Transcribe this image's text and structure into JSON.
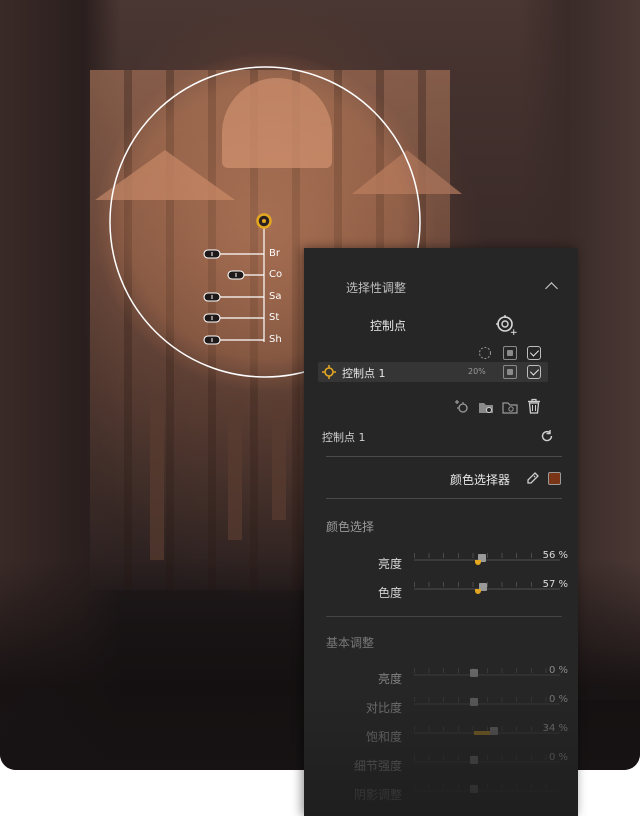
{
  "overlay": {
    "labels": [
      "Br",
      "Co",
      "Sa",
      "St",
      "Sh"
    ],
    "accent_color": "#e4a820"
  },
  "panel": {
    "section_title": "选择性调整",
    "control_points_label": "控制点",
    "control_point_item": {
      "name": "控制点 1",
      "opacity": "20%"
    },
    "selected_point_title": "控制点 1",
    "color_picker_label": "颜色选择器",
    "color_swatch": "#7a3416",
    "color_selection": {
      "title": "颜色选择",
      "sliders": [
        {
          "label": "亮度",
          "value": "56 %"
        },
        {
          "label": "色度",
          "value": "57 %"
        }
      ]
    },
    "basic_adjust": {
      "title": "基本调整",
      "sliders": [
        {
          "label": "亮度",
          "value": "0 %"
        },
        {
          "label": "对比度",
          "value": "0 %"
        },
        {
          "label": "饱和度",
          "value": "34 %"
        },
        {
          "label": "细节强度",
          "value": "0 %"
        },
        {
          "label": "阴影调整",
          "value": ""
        }
      ]
    }
  }
}
